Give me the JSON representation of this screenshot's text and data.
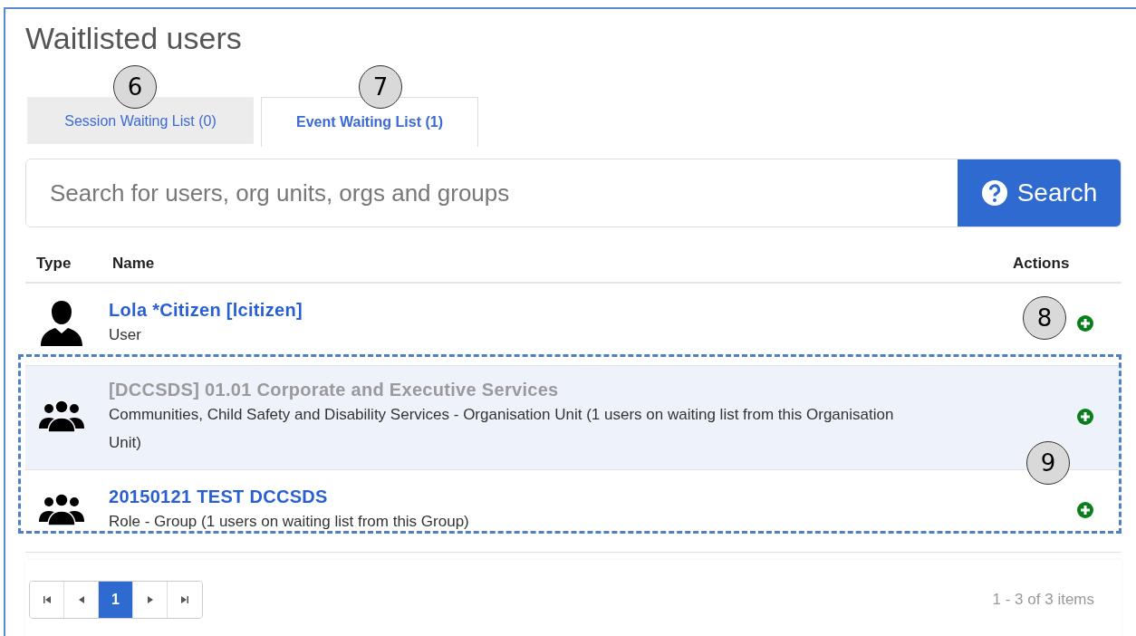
{
  "title": "Waitlisted users",
  "tabs": [
    {
      "label": "Session Waiting List (0)",
      "selected": false
    },
    {
      "label": "Event Waiting List (1)",
      "selected": true
    }
  ],
  "search": {
    "placeholder": "Search for users, org units, orgs and groups",
    "button": "Search"
  },
  "table": {
    "columns": [
      "Type",
      "Name",
      "Actions"
    ],
    "rows": [
      {
        "kind": "user",
        "name": "Lola *Citizen [lcitizen]",
        "detail": "User",
        "highlighted": false
      },
      {
        "kind": "group",
        "name": "[DCCSDS] 01.01 Corporate and Executive Services",
        "detail": "Communities, Child Safety and Disability Services - Organisation Unit (1 users on waiting list from this Organisation Unit)",
        "highlighted": true
      },
      {
        "kind": "group",
        "name": "20150121 TEST DCCSDS",
        "detail": "Role - Group (1 users on waiting list from this Group)",
        "highlighted": false
      }
    ]
  },
  "pager": {
    "pages": [
      {
        "label": "1",
        "selected": true
      }
    ],
    "summary": "1 - 3 of 3 items"
  },
  "callouts": [
    "6",
    "7",
    "8",
    "9"
  ]
}
